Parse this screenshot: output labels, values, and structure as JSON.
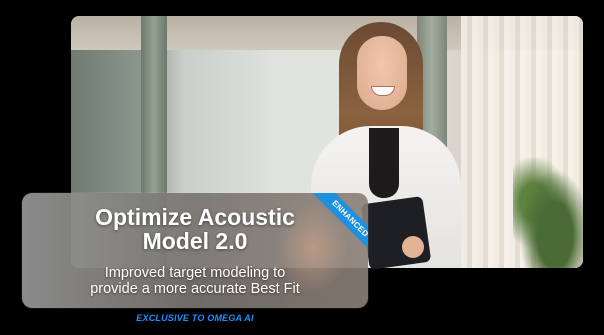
{
  "card": {
    "title_line1": "Optimize Acoustic",
    "title_line2": "Model 2.0",
    "subtitle_line1": "Improved target modeling to",
    "subtitle_line2": "provide a more accurate Best Fit",
    "badge": "ENHANCED"
  },
  "footer": {
    "exclusive": "EXCLUSIVE TO OMEGA AI"
  },
  "colors": {
    "background": "#000000",
    "badge": "#1e90e0",
    "exclusive_text": "#1e90ff",
    "title_text": "#ffffff"
  }
}
